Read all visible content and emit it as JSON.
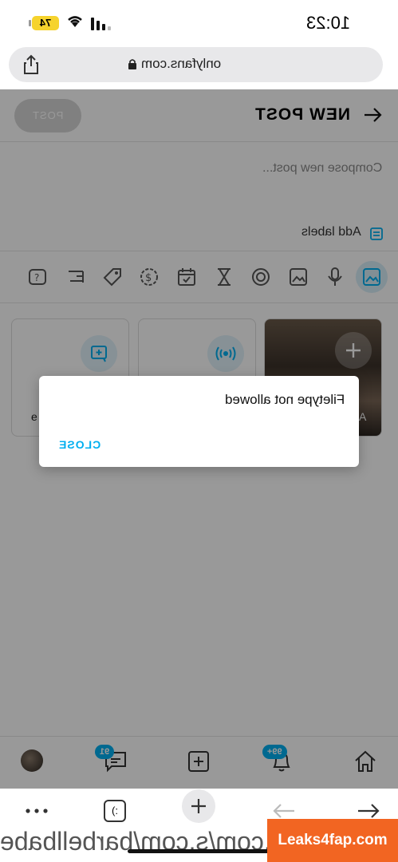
{
  "status_bar": {
    "time": "10:23",
    "battery": "74"
  },
  "browser": {
    "url": "onlyfans.com",
    "address_strip": "barbellbabe.com/s.com/barbellbabe",
    "tabs_count": ":)"
  },
  "header": {
    "title": "NEW POST",
    "post_button": "POST"
  },
  "composer": {
    "placeholder": "Compose new post...",
    "add_labels": "Add labels"
  },
  "toolbar": {
    "icons": [
      "image-icon",
      "microphone-icon",
      "gallery-icon",
      "poll-icon",
      "timer-icon",
      "calendar-icon",
      "dollar-icon",
      "tag-icon",
      "text-format-icon",
      "question-icon"
    ]
  },
  "cards": [
    {
      "label": "A"
    },
    {
      "label": ""
    },
    {
      "label": "e"
    }
  ],
  "bottom_nav": {
    "messages_badge": "91",
    "notifications_badge": "99+"
  },
  "dialog": {
    "message": "Filetype not allowed",
    "close_label": "CLOSE"
  },
  "watermark": "Leaks4fap.com",
  "colors": {
    "accent": "#00aff0",
    "battery": "#f6d32d",
    "watermark_bg": "#f26522"
  }
}
